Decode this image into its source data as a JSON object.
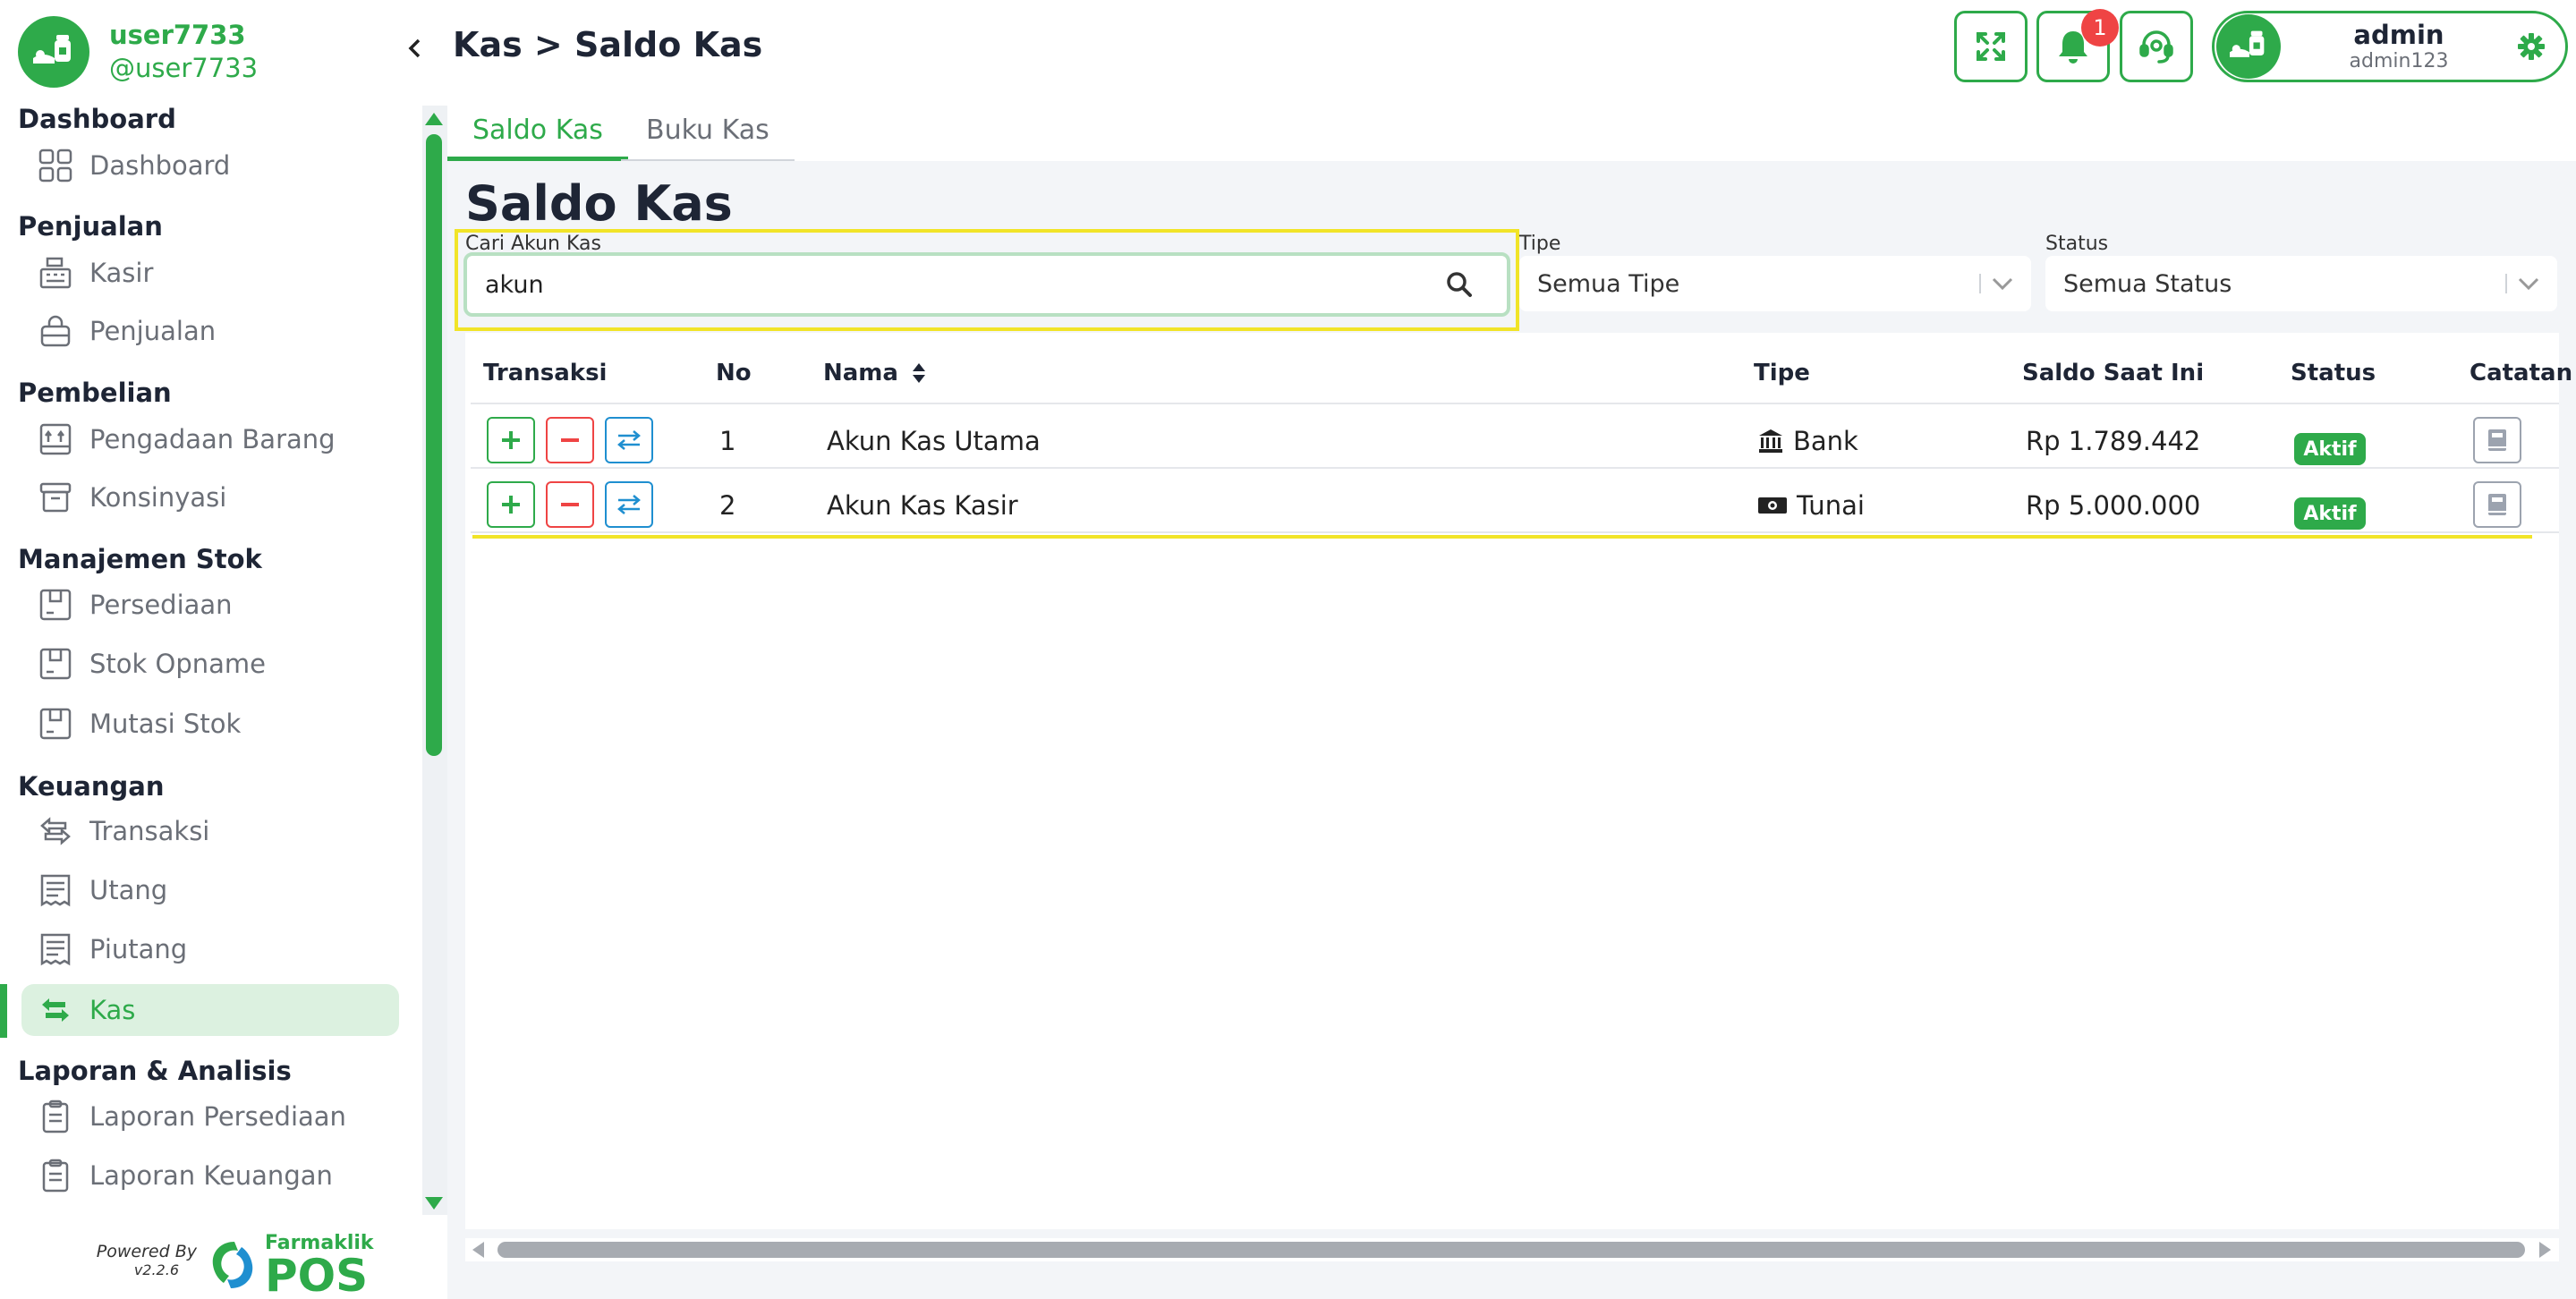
{
  "sidebar": {
    "user_name": "user7733",
    "user_handle": "@user7733",
    "groups": [
      {
        "title": "Dashboard",
        "items": [
          {
            "label": "Dashboard",
            "icon": "grid-icon"
          }
        ]
      },
      {
        "title": "Penjualan",
        "items": [
          {
            "label": "Kasir",
            "icon": "cash-register-icon"
          },
          {
            "label": "Penjualan",
            "icon": "shopping-bag-icon"
          }
        ]
      },
      {
        "title": "Pembelian",
        "items": [
          {
            "label": "Pengadaan Barang",
            "icon": "inbox-upload-icon"
          },
          {
            "label": "Konsinyasi",
            "icon": "archive-box-icon"
          }
        ]
      },
      {
        "title": "Manajemen Stok",
        "items": [
          {
            "label": "Persediaan",
            "icon": "box-icon"
          },
          {
            "label": "Stok Opname",
            "icon": "box-icon"
          },
          {
            "label": "Mutasi Stok",
            "icon": "box-icon"
          }
        ]
      },
      {
        "title": "Keuangan",
        "items": [
          {
            "label": "Transaksi",
            "icon": "exchange-icon"
          },
          {
            "label": "Utang",
            "icon": "receipt-icon"
          },
          {
            "label": "Piutang",
            "icon": "receipt-icon"
          },
          {
            "label": "Kas",
            "icon": "exchange-icon"
          }
        ]
      },
      {
        "title": "Laporan & Analisis",
        "items": [
          {
            "label": "Laporan Persediaan",
            "icon": "clipboard-icon"
          },
          {
            "label": "Laporan Keuangan",
            "icon": "clipboard-icon"
          }
        ]
      }
    ],
    "active_item": "Kas",
    "powered_by": "Powered By",
    "version": "v2.2.6",
    "brand_top": "Farmaklik",
    "brand_bottom": "POS"
  },
  "header": {
    "breadcrumb": "Kas > Saldo Kas",
    "notification_count": "1",
    "profile_name": "admin",
    "profile_sub": "admin123"
  },
  "tabs": [
    {
      "label": "Saldo Kas",
      "active": true
    },
    {
      "label": "Buku Kas",
      "active": false
    }
  ],
  "page": {
    "title": "Saldo Kas",
    "search_label": "Cari Akun Kas",
    "search_value": "akun",
    "tipe_label": "Tipe",
    "tipe_value": "Semua Tipe",
    "status_label": "Status",
    "status_value": "Semua Status"
  },
  "table": {
    "headers": {
      "transaksi": "Transaksi",
      "no": "No",
      "nama": "Nama",
      "tipe": "Tipe",
      "saldo": "Saldo Saat Ini",
      "status": "Status",
      "catatan": "Catatan"
    },
    "rows": [
      {
        "no": "1",
        "nama": "Akun Kas Utama",
        "tipe": "Bank",
        "tipe_icon": "bank-icon",
        "saldo": "Rp 1.789.442",
        "status": "Aktif"
      },
      {
        "no": "2",
        "nama": "Akun Kas Kasir",
        "tipe": "Tunai",
        "tipe_icon": "money-bill-icon",
        "saldo": "Rp 5.000.000",
        "status": "Aktif"
      }
    ]
  },
  "colors": {
    "accent": "#2eaa4a",
    "danger": "#ef4444",
    "info": "#1f8fd0",
    "highlight": "#f1e428"
  }
}
